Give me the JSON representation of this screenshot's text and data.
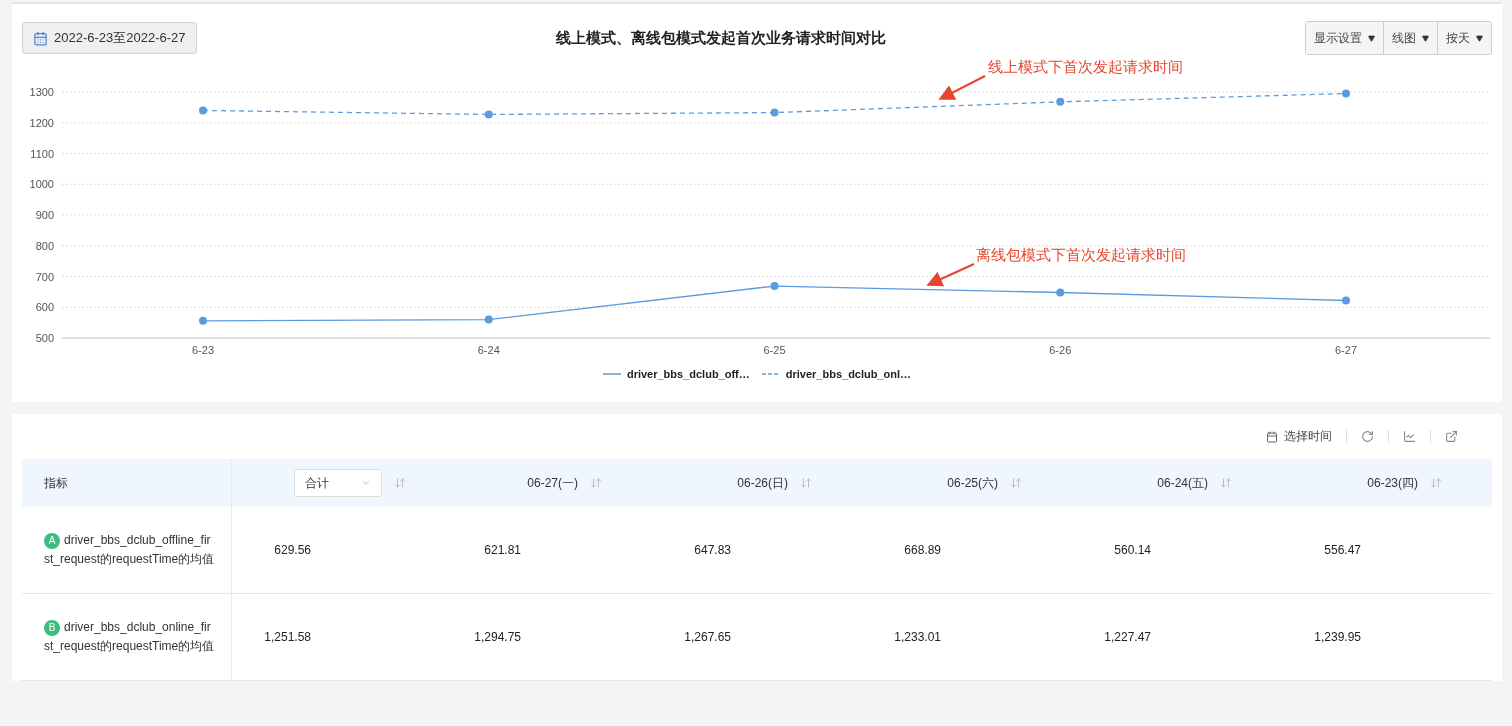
{
  "chart_card": {
    "date_range": "2022-6-23至2022-6-27",
    "title": "线上模式、离线包模式发起首次业务请求时间对比",
    "controls": [
      {
        "label": "显示设置"
      },
      {
        "label": "线图"
      },
      {
        "label": "按天"
      }
    ],
    "chart_data": {
      "type": "line",
      "grid": true,
      "categories": [
        "6-23",
        "6-24",
        "6-25",
        "6-26",
        "6-27"
      ],
      "ylim": [
        500,
        1300
      ],
      "yticks": [
        500,
        600,
        700,
        800,
        900,
        1000,
        1100,
        1200,
        1300
      ],
      "series": [
        {
          "name": "driver_bbs_dclub_off…",
          "color": "#5b9bdf",
          "line_style": "solid",
          "marker": true,
          "values": [
            556,
            560,
            669,
            648,
            622
          ]
        },
        {
          "name": "driver_bbs_dclub_onl…",
          "color": "#5b9bdf",
          "line_style": "dashed",
          "marker": true,
          "values": [
            1240,
            1227,
            1233,
            1268,
            1295
          ]
        }
      ],
      "annotations": [
        {
          "text": "线上模式下首次发起请求时间"
        },
        {
          "text": "离线包模式下首次发起请求时间"
        }
      ]
    }
  },
  "table_card": {
    "toolbar": {
      "time_button": "选择时间"
    },
    "columns": [
      {
        "label": "指标",
        "kind": "name"
      },
      {
        "label": "合计",
        "kind": "select"
      },
      {
        "label": "06-27(一)",
        "kind": "date"
      },
      {
        "label": "06-26(日)",
        "kind": "date"
      },
      {
        "label": "06-25(六)",
        "kind": "date"
      },
      {
        "label": "06-24(五)",
        "kind": "date"
      },
      {
        "label": "06-23(四)",
        "kind": "date"
      }
    ],
    "rows": [
      {
        "badge": "A",
        "name": "driver_bbs_dclub_offline_first_request的requestTime的均值",
        "cells": [
          "629.56",
          "621.81",
          "647.83",
          "668.89",
          "560.14",
          "556.47"
        ]
      },
      {
        "badge": "B",
        "name": "driver_bbs_dclub_online_first_request的requestTime的均值",
        "cells": [
          "1,251.58",
          "1,294.75",
          "1,267.65",
          "1,233.01",
          "1,227.47",
          "1,239.95"
        ]
      }
    ]
  }
}
